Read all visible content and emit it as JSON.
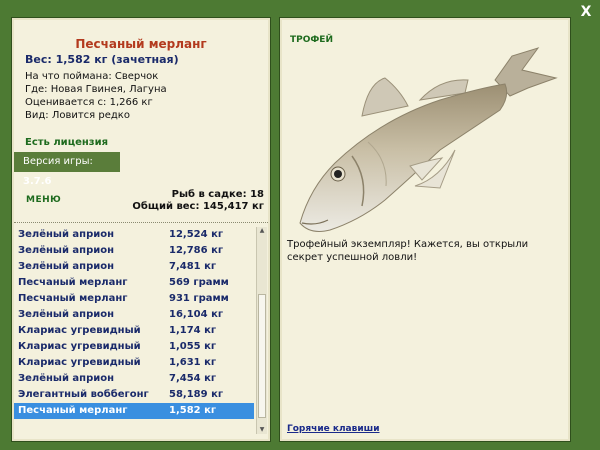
{
  "left": {
    "fish_name": "Песчаный мерланг",
    "weight_line": "Вес: 1,582 кг (зачетная)",
    "info": [
      "На что поймана: Сверчок",
      "Где: Новая Гвинея, Лагуна",
      "Оценивается с: 1,266 кг",
      "Вид: Ловится редко"
    ],
    "license": "Есть лицензия",
    "version_label": "Версия игры: ",
    "version_value": "3.7.6",
    "menu_label": "МЕНЮ",
    "stats_count": "Рыб в садке: 18",
    "stats_weight": "Общий вес: 145,417 кг"
  },
  "list": [
    {
      "name": "Зелёный априон",
      "weight": "12,524 кг"
    },
    {
      "name": "Зелёный априон",
      "weight": "12,786 кг"
    },
    {
      "name": "Зелёный априон",
      "weight": "7,481 кг"
    },
    {
      "name": "Песчаный мерланг",
      "weight": "569 грамм"
    },
    {
      "name": "Песчаный мерланг",
      "weight": "931 грамм"
    },
    {
      "name": "Зелёный априон",
      "weight": "16,104 кг"
    },
    {
      "name": "Клариас угревидный",
      "weight": "1,174 кг"
    },
    {
      "name": "Клариас угревидный",
      "weight": "1,055 кг"
    },
    {
      "name": "Клариас угревидный",
      "weight": "1,631 кг"
    },
    {
      "name": "Зелёный априон",
      "weight": "7,454 кг"
    },
    {
      "name": "Элегантный воббегонг",
      "weight": "58,189 кг"
    },
    {
      "name": "Песчаный мерланг",
      "weight": "1,582 кг"
    }
  ],
  "selected_index": 11,
  "right": {
    "trophy_label": "ТРОФЕЙ",
    "trophy_text": "Трофейный экземпляр! Кажется, вы открыли секрет успешной ловли!",
    "hotkeys": "Горячие клавиши"
  },
  "window": {
    "close_label": "X"
  },
  "colors": {
    "frame": "#4d7a33",
    "panel": "#f4f1dd",
    "title": "#b33a1e",
    "list_text": "#1a2a6a",
    "selected": "#3a8fe0"
  }
}
